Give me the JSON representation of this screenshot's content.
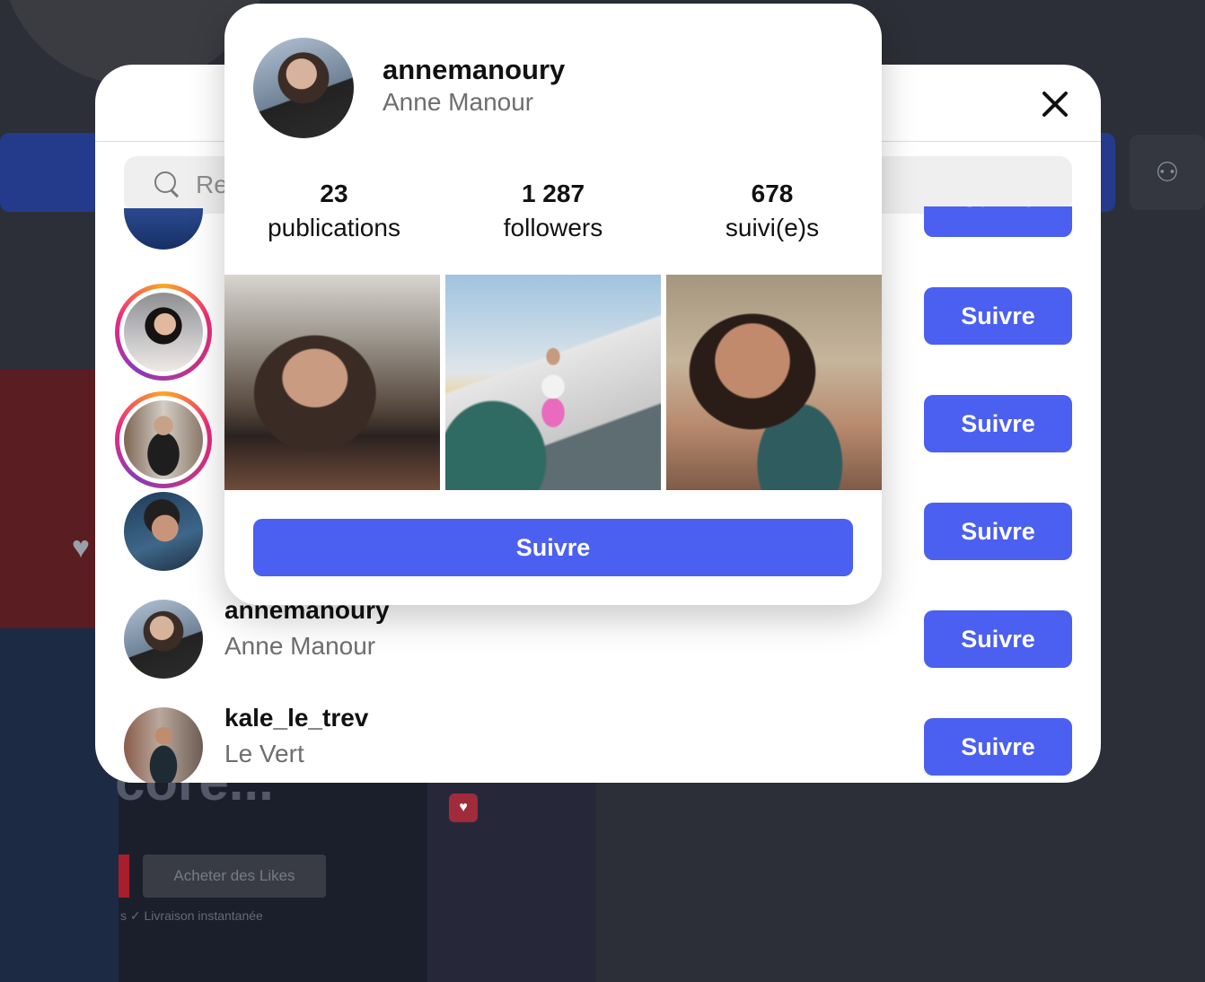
{
  "background": {
    "big_text": "core...",
    "buy_button": "Acheter des Likes",
    "small_text": "s   ✓ Livraison instantanée",
    "add_user_icon": "add-user-icon",
    "heart_icon": "heart-icon"
  },
  "modal": {
    "search_placeholder": "Rechercher",
    "close_icon": "close-icon",
    "follow_label": "Suivre",
    "rows": [
      {
        "username": "",
        "full_name": ""
      },
      {
        "username": "",
        "full_name": ""
      },
      {
        "username": "",
        "full_name": ""
      },
      {
        "username": "",
        "full_name": ""
      },
      {
        "username": "annemanoury",
        "full_name": "Anne Manour"
      },
      {
        "username": "kale_le_trev",
        "full_name": "Le Vert"
      }
    ]
  },
  "card": {
    "username": "annemanoury",
    "full_name": "Anne Manour",
    "stats": [
      {
        "value": "23",
        "label": "publications"
      },
      {
        "value": "1 287",
        "label": "followers"
      },
      {
        "value": "678",
        "label": "suivi(e)s"
      }
    ],
    "follow_label": "Suivre"
  },
  "colors": {
    "accent": "#4b5ff0",
    "overlay": "#2c2f37"
  }
}
